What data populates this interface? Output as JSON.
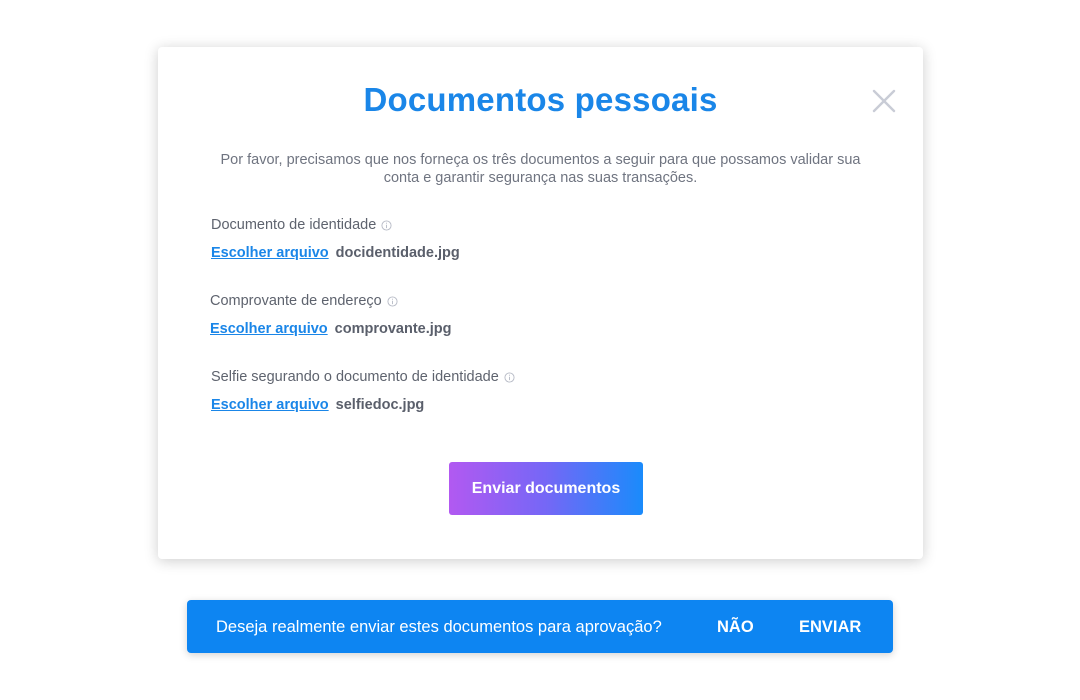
{
  "modal": {
    "title": "Documentos pessoais",
    "description": "Por favor, precisamos que nos forneça os três documentos a seguir para que possamos validar sua conta e garantir segurança nas suas transações.",
    "close_icon": "close-icon",
    "documents": [
      {
        "label": "Documento de identidade",
        "choose_label": "Escolher arquivo",
        "file_name": "docidentidade.jpg",
        "info_icon": "info-icon"
      },
      {
        "label": "Comprovante de endereço",
        "choose_label": "Escolher arquivo",
        "file_name": "comprovante.jpg",
        "info_icon": "info-icon"
      },
      {
        "label": "Selfie segurando o documento de identidade",
        "choose_label": "Escolher arquivo",
        "file_name": "selfiedoc.jpg",
        "info_icon": "info-icon"
      }
    ],
    "submit_label": "Enviar documentos"
  },
  "confirm_bar": {
    "message": "Deseja realmente enviar estes documentos para aprovação?",
    "no_label": "NÃO",
    "send_label": "ENVIAR"
  },
  "colors": {
    "accent": "#1a86e8",
    "button_gradient_start": "#b259f1",
    "button_gradient_end": "#1a8bfb",
    "confirm_bar_bg": "#0d85f2"
  }
}
